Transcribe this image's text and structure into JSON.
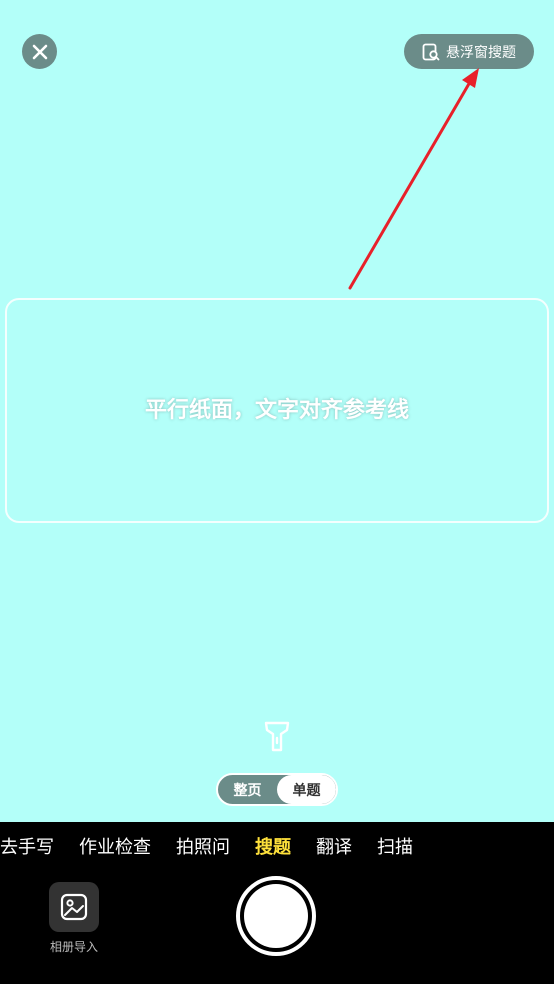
{
  "top": {
    "close_icon": "close-icon",
    "float_button_label": "悬浮窗搜题"
  },
  "frame": {
    "hint": "平行纸面，文字对齐参考线"
  },
  "mode": {
    "options": [
      "整页",
      "单题"
    ],
    "selected": "单题"
  },
  "tabs": {
    "items": [
      "去手写",
      "作业检查",
      "拍照问",
      "搜题",
      "翻译",
      "扫描"
    ],
    "active": "搜题"
  },
  "album": {
    "label": "相册导入"
  },
  "colors": {
    "camera_bg": "#b3fff9",
    "overlay_button": "#6b8c89",
    "active_tab": "#ffe13b",
    "bottom_bar": "#000000",
    "annotation_arrow": "#e8202a"
  }
}
